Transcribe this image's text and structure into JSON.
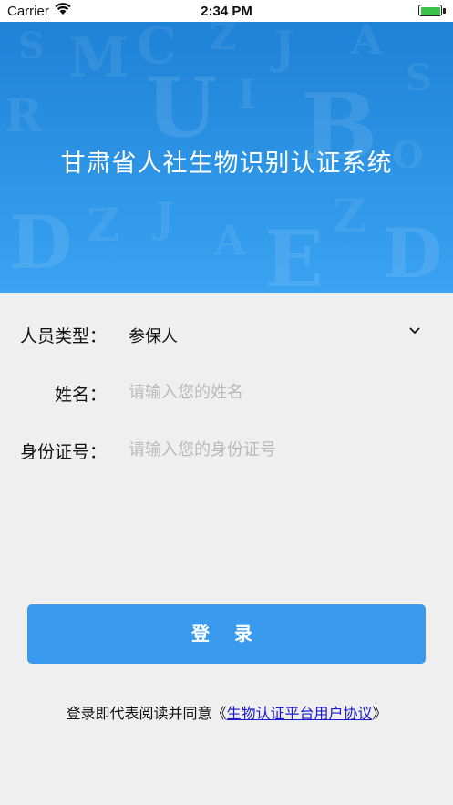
{
  "status_bar": {
    "carrier": "Carrier",
    "time": "2:34 PM",
    "battery_level": 1.0
  },
  "banner": {
    "title": "甘肃省人社生物识别认证系统",
    "background_color": "#2d94e6"
  },
  "form": {
    "person_type": {
      "label": "人员类型：",
      "value": "参保人"
    },
    "name": {
      "label": "姓名：",
      "placeholder": "请输入您的姓名"
    },
    "id_number": {
      "label": "身份证号：",
      "placeholder": "请输入您的身份证号"
    }
  },
  "login_button": {
    "label": "登 录",
    "color": "#3a9bee"
  },
  "agreement": {
    "prefix": "登录即代表阅读并同意《",
    "link": "生物认证平台用户协议",
    "suffix": "》"
  }
}
